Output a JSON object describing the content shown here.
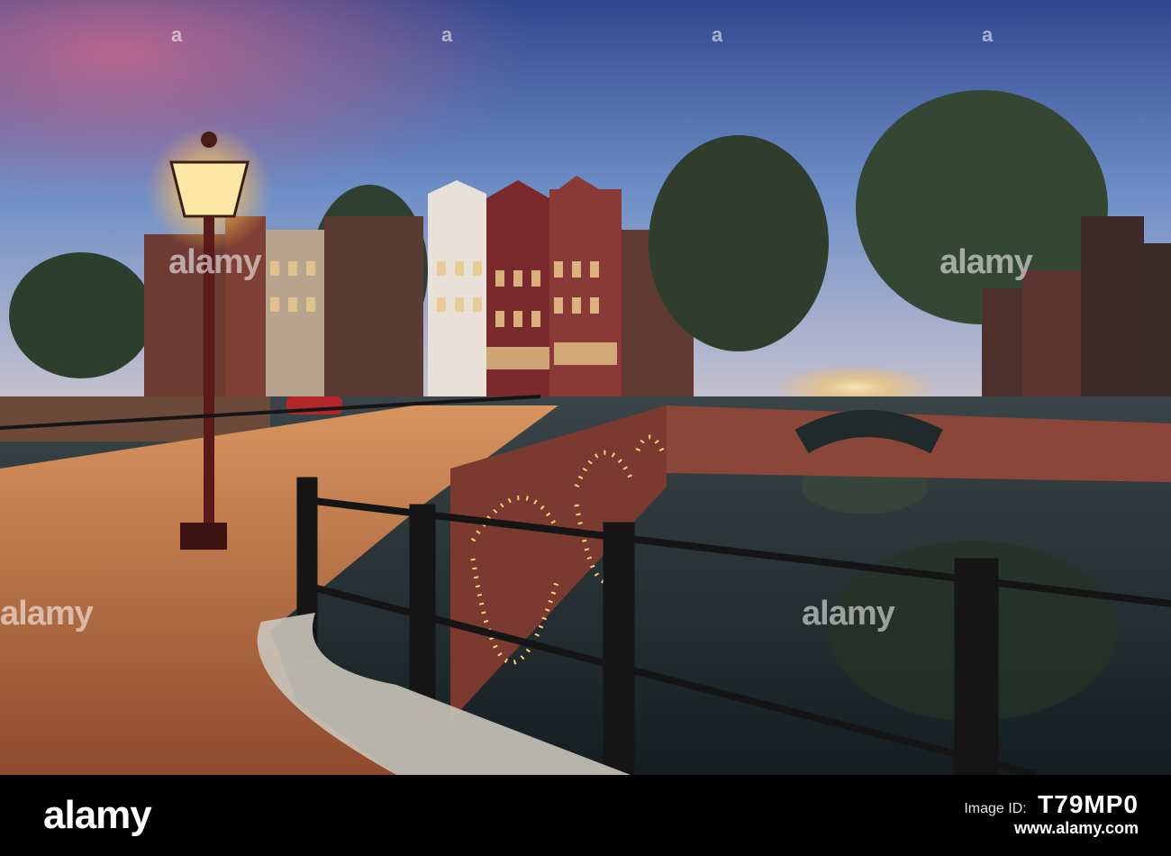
{
  "photo": {
    "watermark_text": "alamy",
    "watermark_dot": "a"
  },
  "footer": {
    "brand": "alamy",
    "id_label": "Image ID:",
    "image_id": "T79MP0",
    "url": "www.alamy.com"
  },
  "colors": {
    "sky_top": "#3f5aa6",
    "sky_bottom": "#c3b7c9",
    "lamp_glow": "#ffd27a",
    "brick": "#b8643a",
    "water": "#1d2a2e"
  }
}
